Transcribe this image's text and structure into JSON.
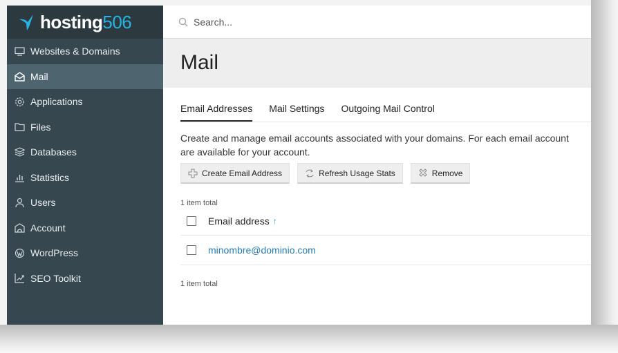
{
  "brand": {
    "name_part1": "hosting",
    "name_part2": "506",
    "logo_icon": "bird-logo-icon"
  },
  "search": {
    "placeholder": "Search..."
  },
  "sidebar": {
    "items": [
      {
        "label": "Websites & Domains",
        "icon": "monitor-icon"
      },
      {
        "label": "Mail",
        "icon": "envelope-open-icon",
        "active": true
      },
      {
        "label": "Applications",
        "icon": "gear-icon"
      },
      {
        "label": "Files",
        "icon": "folder-icon"
      },
      {
        "label": "Databases",
        "icon": "database-icon"
      },
      {
        "label": "Statistics",
        "icon": "bar-chart-icon"
      },
      {
        "label": "Users",
        "icon": "user-icon"
      },
      {
        "label": "Account",
        "icon": "account-icon"
      },
      {
        "label": "WordPress",
        "icon": "wordpress-icon"
      },
      {
        "label": "SEO Toolkit",
        "icon": "trend-chart-icon"
      }
    ]
  },
  "page": {
    "title": "Mail"
  },
  "tabs": [
    {
      "label": "Email Addresses",
      "active": true
    },
    {
      "label": "Mail Settings"
    },
    {
      "label": "Outgoing Mail Control"
    }
  ],
  "description": {
    "line1": "Create and manage email accounts associated with your domains. For each email account",
    "line2": "are available for your account."
  },
  "toolbar": {
    "create_label": "Create Email Address",
    "refresh_label": "Refresh Usage Stats",
    "remove_label": "Remove"
  },
  "list": {
    "count_top": "1 item total",
    "column_header": "Email address",
    "sort_indicator": "↑",
    "rows": [
      {
        "email": "minombre@dominio.com"
      }
    ],
    "count_bottom": "1 item total"
  },
  "colors": {
    "sidebar_bg": "#37474f",
    "sidebar_active": "#4e646e",
    "brand_accent": "#28b3e2",
    "link": "#1e7cb8"
  }
}
